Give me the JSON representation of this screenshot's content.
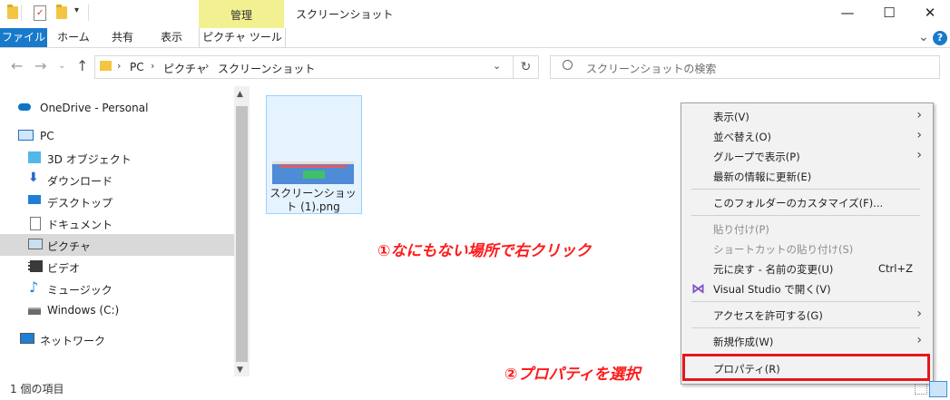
{
  "window": {
    "title": "スクリーンショット",
    "context_tab": "管理",
    "min_glyph": "—",
    "max_glyph": "☐",
    "close_glyph": "✕"
  },
  "ribbon": {
    "tabs": [
      "ファイル",
      "ホーム",
      "共有",
      "表示",
      "ピクチャ ツール"
    ],
    "expand_glyph": "⌄",
    "help_glyph": "?"
  },
  "address": {
    "crumbs": [
      "PC",
      "ピクチャ",
      "スクリーンショット"
    ],
    "search_placeholder": "スクリーンショットの検索"
  },
  "nav": {
    "items": [
      {
        "label": "OneDrive - Personal",
        "icon": "cloud-icon"
      },
      {
        "label": "PC",
        "icon": "pc-icon"
      },
      {
        "label": "3D オブジェクト",
        "icon": "cube-icon"
      },
      {
        "label": "ダウンロード",
        "icon": "download-icon"
      },
      {
        "label": "デスクトップ",
        "icon": "desktop-icon"
      },
      {
        "label": "ドキュメント",
        "icon": "document-icon"
      },
      {
        "label": "ピクチャ",
        "icon": "picture-icon"
      },
      {
        "label": "ビデオ",
        "icon": "video-icon"
      },
      {
        "label": "ミュージック",
        "icon": "music-icon"
      },
      {
        "label": "Windows (C:)",
        "icon": "drive-icon"
      },
      {
        "label": "ネットワーク",
        "icon": "network-icon"
      }
    ],
    "selected": "ピクチャ"
  },
  "files": [
    {
      "name": "スクリーンショット (1).png"
    }
  ],
  "annotations": {
    "step1": "①なにもない場所で右クリック",
    "step2": "②プロパティを選択"
  },
  "context_menu": {
    "items": [
      {
        "label": "表示(V)",
        "submenu": true
      },
      {
        "label": "並べ替え(O)",
        "submenu": true
      },
      {
        "label": "グループで表示(P)",
        "submenu": true
      },
      {
        "label": "最新の情報に更新(E)"
      },
      {
        "label": "このフォルダーのカスタマイズ(F)..."
      },
      {
        "label": "貼り付け(P)",
        "disabled": true
      },
      {
        "label": "ショートカットの貼り付け(S)",
        "disabled": true
      },
      {
        "label": "元に戻す - 名前の変更(U)",
        "shortcut": "Ctrl+Z"
      },
      {
        "label": "Visual Studio で開く(V)",
        "icon": "visual-studio-icon"
      },
      {
        "label": "アクセスを許可する(G)",
        "submenu": true
      },
      {
        "label": "新規作成(W)",
        "submenu": true
      },
      {
        "label": "プロパティ(R)"
      }
    ],
    "submenu_glyph": "›"
  },
  "status": {
    "item_count": "1 個の項目"
  },
  "colors": {
    "file_tab": "#1979ca",
    "context_tab": "#f3f092",
    "annotation": "#ff1a1a"
  }
}
